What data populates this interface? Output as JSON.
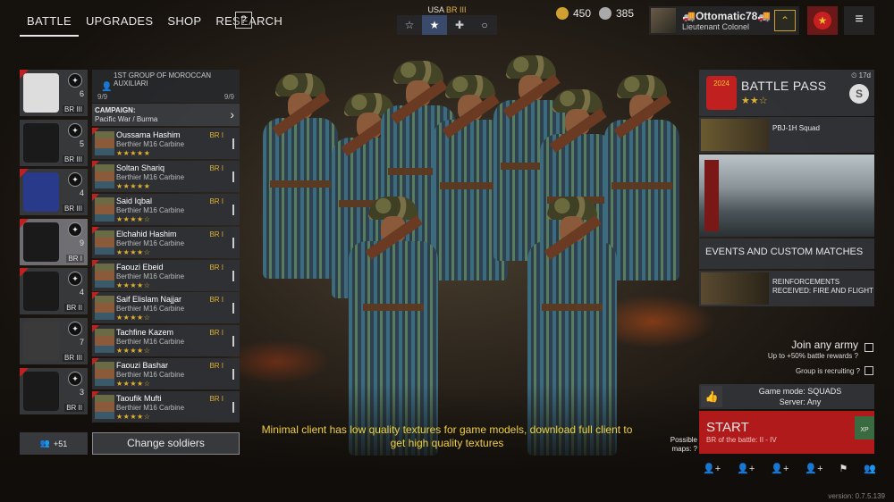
{
  "nav": {
    "tabs": [
      "BATTLE",
      "UPGRADES",
      "SHOP",
      "RESEARCH"
    ],
    "help": "?"
  },
  "country": {
    "name": "USA",
    "br": "BR III",
    "tabs": [
      "☆",
      "★",
      "✚",
      "○"
    ]
  },
  "currency": {
    "gold": "450",
    "silver": "385"
  },
  "profile": {
    "name": "🚚Ottomatic78🚚",
    "rank": "Lieutenant Colonel"
  },
  "squads": [
    {
      "count": "6",
      "br": "BR III",
      "ico": "✦"
    },
    {
      "count": "5",
      "br": "BR III",
      "ico": "✦"
    },
    {
      "count": "4",
      "br": "BR III",
      "ico": "✦"
    },
    {
      "count": "9",
      "br": "BR I",
      "ico": "✦"
    },
    {
      "count": "4",
      "br": "BR II",
      "ico": "✦"
    },
    {
      "count": "7",
      "br": "BR III",
      "ico": "✦"
    },
    {
      "count": "3",
      "br": "BR II",
      "ico": "✦"
    }
  ],
  "list": {
    "title": "1ST GROUP OF MOROCCAN AUXILIARI",
    "count_left": "9/9",
    "count_right": "9/9",
    "campaign_label": "CAMPAIGN:",
    "campaign_value": "Pacific War / Burma"
  },
  "soldiers": [
    {
      "name": "Oussama Hashim",
      "weapon": "Berthier M16 Carbine",
      "stars": "★★★★★",
      "br": "BR I"
    },
    {
      "name": "Soltan Shariq",
      "weapon": "Berthier M16 Carbine",
      "stars": "★★★★★",
      "br": "BR I"
    },
    {
      "name": "Said Iqbal",
      "weapon": "Berthier M16 Carbine",
      "stars": "★★★★☆",
      "br": "BR I"
    },
    {
      "name": "Elchahid Hashim",
      "weapon": "Berthier M16 Carbine",
      "stars": "★★★★☆",
      "br": "BR I"
    },
    {
      "name": "Faouzi Ebeid",
      "weapon": "Berthier M16 Carbine",
      "stars": "★★★★☆",
      "br": "BR I"
    },
    {
      "name": "Saif Elislam Najjar",
      "weapon": "Berthier M16 Carbine",
      "stars": "★★★★☆",
      "br": "BR I"
    },
    {
      "name": "Tachfine Kazem",
      "weapon": "Berthier M16 Carbine",
      "stars": "★★★★☆",
      "br": "BR I"
    },
    {
      "name": "Faouzi Bashar",
      "weapon": "Berthier M16 Carbine",
      "stars": "★★★★☆",
      "br": "BR I"
    },
    {
      "name": "Taoufik Mufti",
      "weapon": "Berthier M16 Carbine",
      "stars": "★★★★☆",
      "br": "BR I"
    }
  ],
  "bottom": {
    "reserve": "+51",
    "change": "Change soldiers"
  },
  "notice": "Minimal client has low quality textures for game models, download full client to get high quality textures",
  "battle_pass": {
    "title": "BATTLE PASS",
    "stars": "★★☆",
    "time": "17d",
    "year": "2024",
    "badge": "S"
  },
  "pbj": {
    "title": "PBJ-1H Squad"
  },
  "events": {
    "title": "EVENTS AND CUSTOM MATCHES"
  },
  "reinforcements": {
    "title": "REINFORCEMENTS RECEIVED: FIRE AND FLIGHT"
  },
  "join": {
    "title": "Join any army",
    "sub": "Up to +50% battle rewards",
    "recruit": "Group is recruiting"
  },
  "game_mode": {
    "mode": "Game mode: SQUADS",
    "server": "Server: Any"
  },
  "start": {
    "title": "START",
    "sub": "BR of the battle: II - IV",
    "xp": "XP"
  },
  "possible_maps": "Possible maps:",
  "version": "version: 0.7.5.139"
}
